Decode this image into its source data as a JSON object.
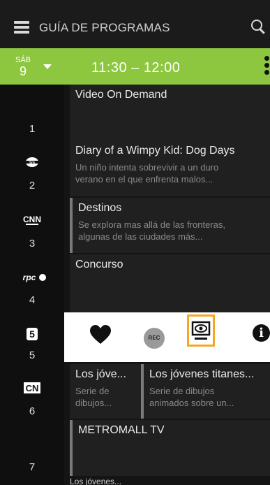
{
  "header": {
    "title": "GUÍA DE PROGRAMAS"
  },
  "date_bar": {
    "day": "SÁB",
    "day_number": "9",
    "time_range": "11:30 – 12:00"
  },
  "channels": [
    {
      "number": "1",
      "logo": ""
    },
    {
      "number": "2",
      "logo": "tvn"
    },
    {
      "number": "3",
      "logo": "CNN"
    },
    {
      "number": "4",
      "logo": "rpc"
    },
    {
      "number": "5",
      "logo": "5"
    },
    {
      "number": "6",
      "logo": "CN"
    },
    {
      "number": "7",
      "logo": ""
    }
  ],
  "programs": [
    {
      "title": "Video On Demand",
      "desc1": "",
      "desc2": ""
    },
    {
      "title": "Diary of a Wimpy Kid: Dog Days",
      "desc1": "Un niño intenta sobrevivir a un duro",
      "desc2": "verano en el que enfrenta malos..."
    },
    {
      "title": "Destinos",
      "desc1": "Se explora mas allá de las fronteras,",
      "desc2": "algunas de las ciudades más..."
    },
    {
      "title": "Concurso",
      "desc1": "",
      "desc2": ""
    },
    {
      "title": "Los jóve...",
      "desc1": "Serie de",
      "desc2": "dibujos..."
    },
    {
      "title": "Los jóvenes titanes...",
      "desc1": "Serie de dibujos",
      "desc2": "animados sobre un..."
    },
    {
      "title": "METROMALL TV",
      "desc1": "",
      "desc2": ""
    }
  ],
  "actions": {
    "favorite_icon": "heart-icon",
    "record_label": "REC",
    "watch_icon": "tv-eye-icon",
    "info_icon": "info-icon",
    "highlight_color": "#f5a623"
  },
  "cutoff_text": "Los jóvenes..."
}
